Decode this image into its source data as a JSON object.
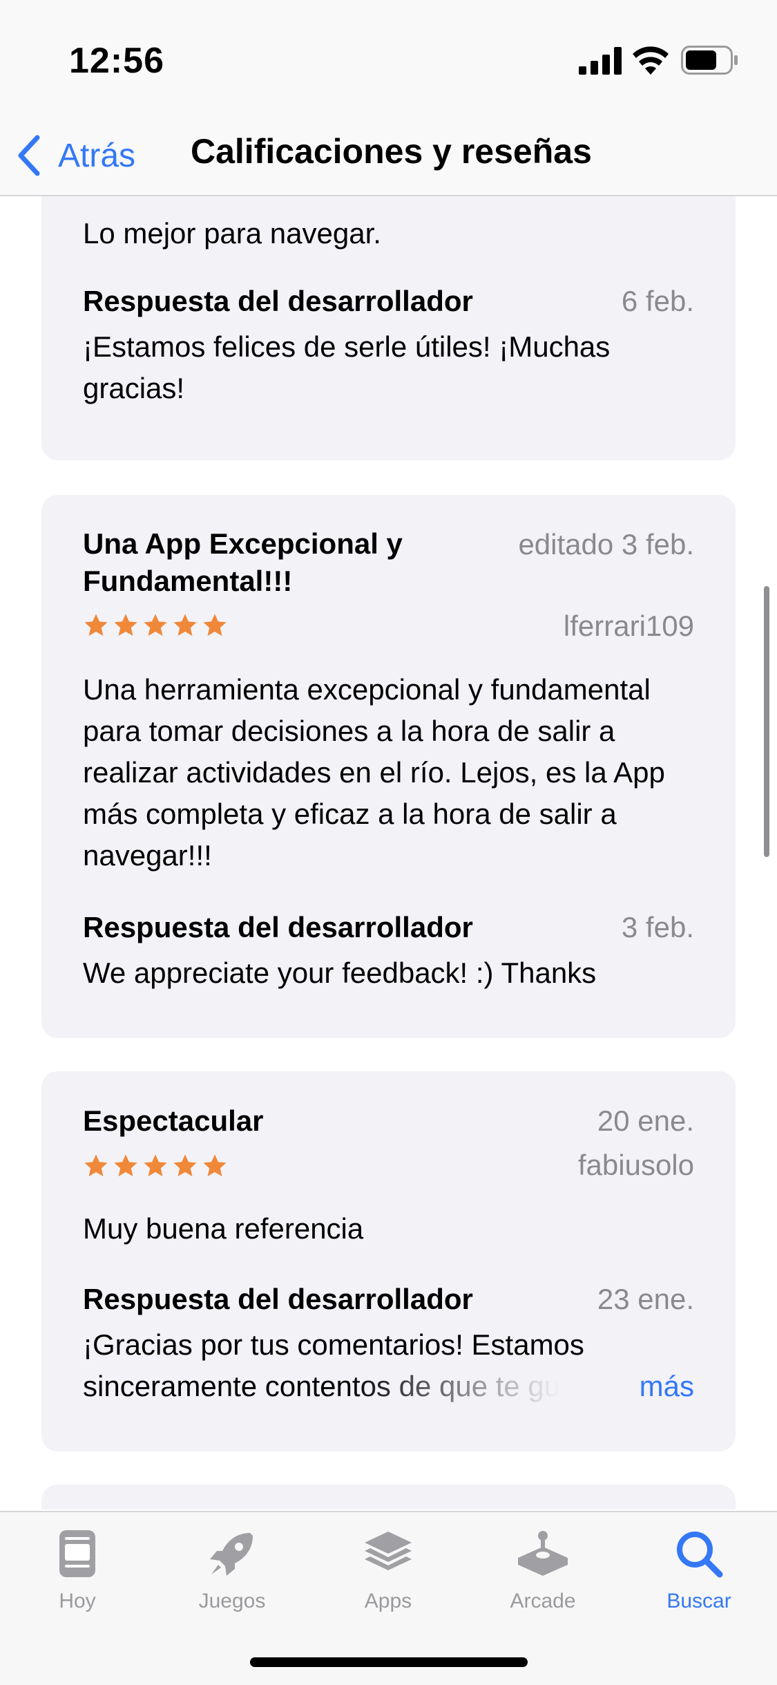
{
  "status": {
    "time": "12:56"
  },
  "nav": {
    "back_label": "Atrás",
    "title": "Calificaciones y reseñas"
  },
  "reviews": [
    {
      "body": "Lo mejor para navegar.",
      "reply": {
        "label": "Respuesta del desarrollador",
        "date": "6 feb.",
        "text": "¡Estamos felices de serle útiles! ¡Muchas gracias!"
      }
    },
    {
      "title": "Una App Excepcional y Fundamental!!!",
      "date": "editado 3 feb.",
      "author": "lferrari109",
      "rating": 5,
      "body": "Una herramienta excepcional y fundamental para tomar decisiones a la hora de salir a realizar actividades en el río. Lejos, es la App más completa y eficaz a la hora de salir a navegar!!!",
      "reply": {
        "label": "Respuesta del desarrollador",
        "date": "3 feb.",
        "text": "We appreciate your feedback! :) Thanks"
      }
    },
    {
      "title": "Espectacular",
      "date": "20 ene.",
      "author": "fabiusolo",
      "rating": 5,
      "body": "Muy buena referencia",
      "reply": {
        "label": "Respuesta del desarrollador",
        "date": "23 ene.",
        "text_line1": "¡Gracias por tus comentarios! Estamos",
        "text_line2": "sinceramente contentos de que te gu",
        "more_label": "más"
      }
    }
  ],
  "colors": {
    "accent": "#3478f6",
    "star": "#f0883a",
    "card_bg": "#f2f2f7",
    "secondary_text": "#8a8a8e"
  },
  "tabs": [
    {
      "label": "Hoy",
      "icon": "today-icon",
      "active": false
    },
    {
      "label": "Juegos",
      "icon": "rocket-icon",
      "active": false
    },
    {
      "label": "Apps",
      "icon": "apps-stack-icon",
      "active": false
    },
    {
      "label": "Arcade",
      "icon": "arcade-joystick-icon",
      "active": false
    },
    {
      "label": "Buscar",
      "icon": "search-icon",
      "active": true
    }
  ]
}
